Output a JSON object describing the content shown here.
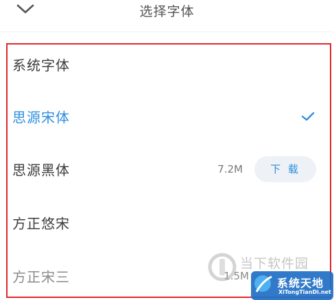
{
  "header": {
    "back_icon": "chevron-down-icon",
    "title": "选择字体"
  },
  "fonts": [
    {
      "label": "系统字体",
      "selected": false
    },
    {
      "label": "思源宋体",
      "selected": true,
      "status_icon": "checkmark-icon"
    },
    {
      "label": "思源黑体",
      "selected": false,
      "size": "7.2M",
      "action": "下 载"
    },
    {
      "label": "方正悠宋",
      "selected": false
    },
    {
      "label": "方正宋三",
      "selected": false,
      "size": "1.5M"
    }
  ],
  "watermark": {
    "line1": "当下软件园",
    "line2": "系统天地",
    "line3": "XiTongTianDi.net"
  },
  "colors": {
    "accent": "#2d8fe0",
    "highlight_border": "#e0262b",
    "button_bg": "#eef1f5"
  }
}
